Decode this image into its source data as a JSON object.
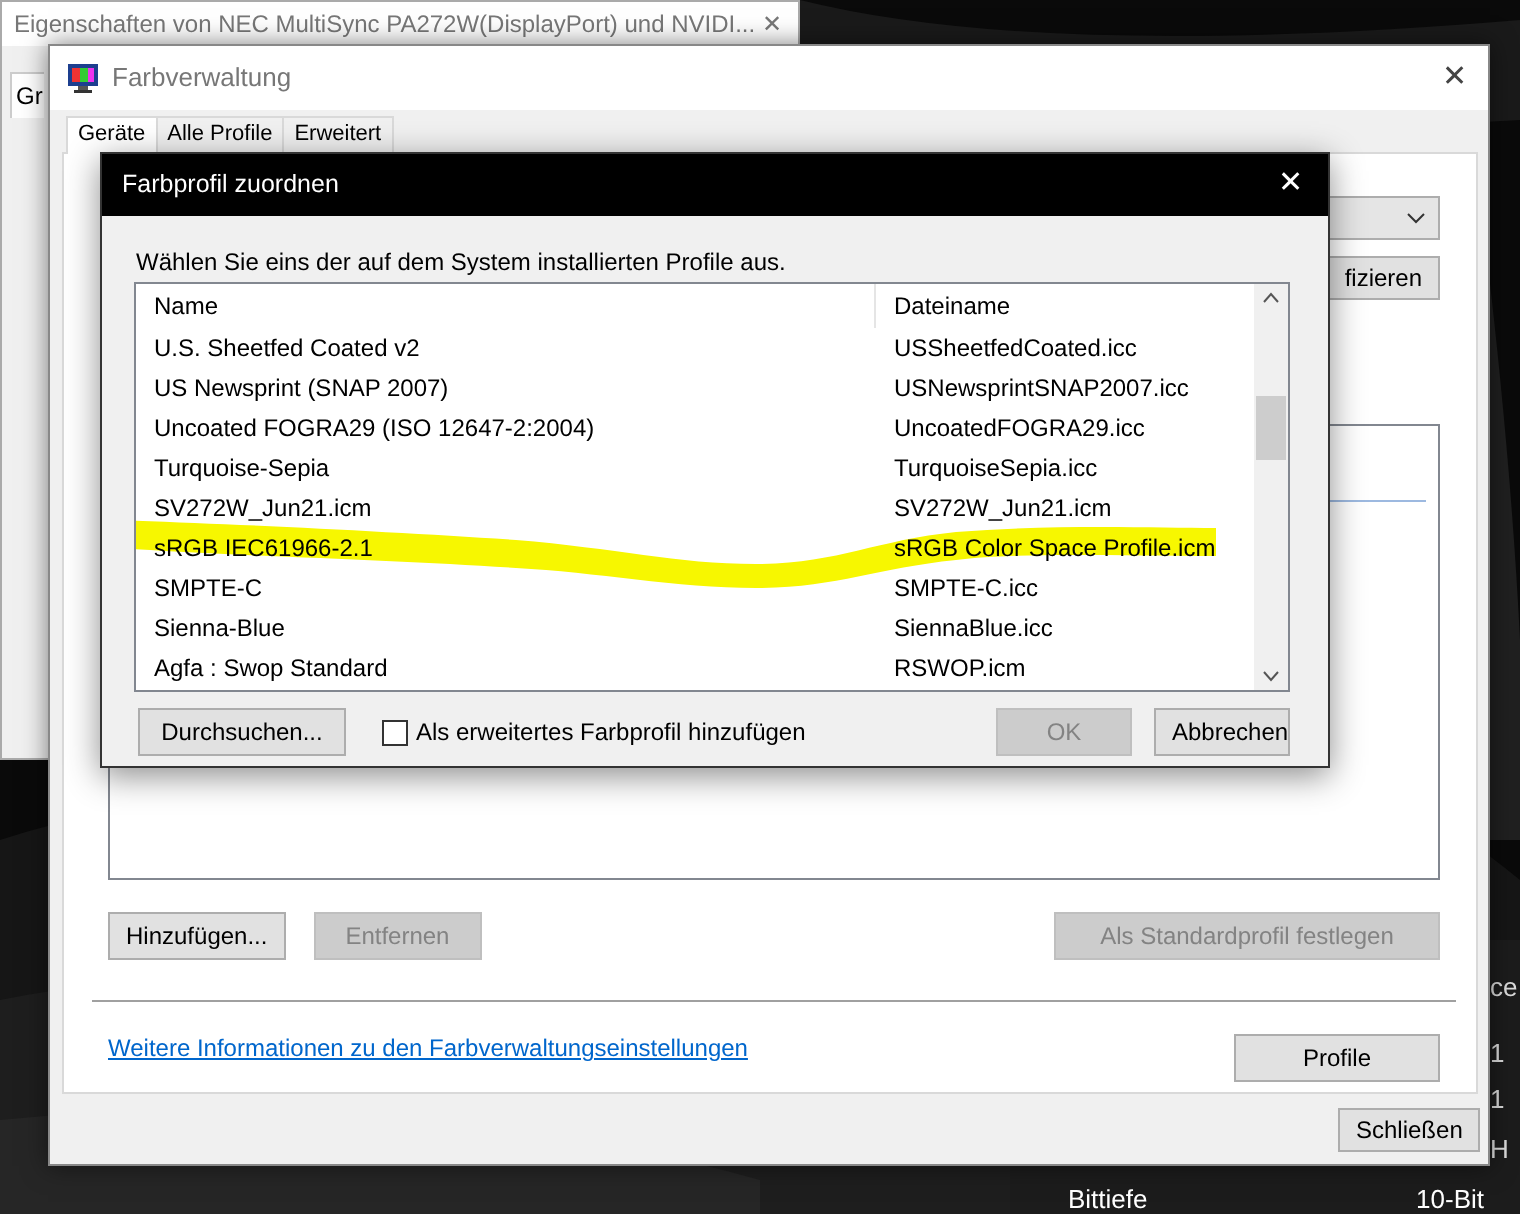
{
  "background_window": {
    "title": "Eigenschaften von NEC MultiSync PA272W(DisplayPort) und NVIDI...",
    "close": "✕",
    "tabs": [
      {
        "label": "Gr"
      }
    ]
  },
  "side_panel": {
    "fragments": [
      "ce",
      "1",
      "1",
      "H"
    ],
    "rows": [
      {
        "label": "Bittiefe",
        "value": "10-Bit"
      }
    ]
  },
  "window": {
    "title": "Farbverwaltung",
    "close": "✕",
    "tabs": [
      {
        "label": "Geräte",
        "selected": true
      },
      {
        "label": "Alle Profile",
        "selected": false
      },
      {
        "label": "Erweitert",
        "selected": false
      }
    ],
    "panel": {
      "button_fragment": "fizieren",
      "buttons": [
        {
          "label": "Hinzufügen...",
          "disabled": false
        },
        {
          "label": "Entfernen",
          "disabled": true
        },
        {
          "label": "Als Standardprofil festlegen",
          "disabled": true
        }
      ],
      "link": "Weitere Informationen zu den Farbverwaltungseinstellungen",
      "profile_button": "Profile"
    },
    "close_button": "Schließen"
  },
  "dialog": {
    "title": "Farbprofil zuordnen",
    "close": "✕",
    "instruction": "Wählen Sie eins der auf dem System installierten Profile aus.",
    "columns": [
      "Name",
      "Dateiname"
    ],
    "rows": [
      {
        "name": "U.S. Sheetfed Coated v2",
        "file": "USSheetfedCoated.icc",
        "marked": false
      },
      {
        "name": "US Newsprint (SNAP 2007)",
        "file": "USNewsprintSNAP2007.icc",
        "marked": false
      },
      {
        "name": "Uncoated FOGRA29 (ISO 12647-2:2004)",
        "file": "UncoatedFOGRA29.icc",
        "marked": false
      },
      {
        "name": "Turquoise-Sepia",
        "file": "TurquoiseSepia.icc",
        "marked": false
      },
      {
        "name": "SV272W_Jun21.icm",
        "file": "SV272W_Jun21.icm",
        "marked": false
      },
      {
        "name": "sRGB IEC61966-2.1",
        "file": "sRGB Color Space Profile.icm",
        "marked": true
      },
      {
        "name": "SMPTE-C",
        "file": "SMPTE-C.icc",
        "marked": false
      },
      {
        "name": "Sienna-Blue",
        "file": "SiennaBlue.icc",
        "marked": false
      },
      {
        "name": "Agfa : Swop Standard",
        "file": "RSWOP.icm",
        "marked": false
      }
    ],
    "browse_button": "Durchsuchen...",
    "checkbox": {
      "label": "Als erweitertes Farbprofil hinzufügen",
      "checked": false
    },
    "buttons": [
      {
        "label": "OK",
        "disabled": true
      },
      {
        "label": "Abbrechen",
        "disabled": false
      }
    ]
  }
}
